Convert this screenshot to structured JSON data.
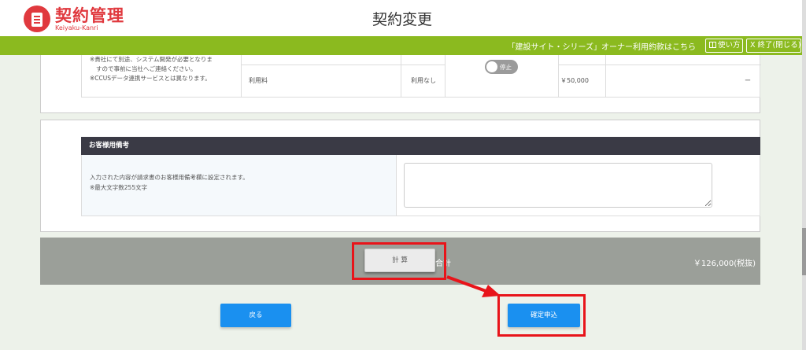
{
  "header": {
    "logo_title": "契約管理",
    "logo_sub": "Keiyaku-Kanri",
    "page_title": "契約変更"
  },
  "nav": {
    "terms_link": "「建設サイト・シリーズ」オーナー利用約款はこちら",
    "help_button": "使い方",
    "exit_button": "X 終了(閉じる)"
  },
  "fee_section": {
    "notes": [
      "※貴社にて別途、システム開発が必要となりま",
      "すので事前に当社へご連絡ください。",
      "※CCUSデータ連携サービスとは異なります。"
    ],
    "row_label": "利用料",
    "usage_status": "利用なし",
    "toggle_label": "停止",
    "price": "￥50,000",
    "dash": "ー"
  },
  "memo": {
    "heading": "お客様用備考",
    "note_line1": "入力された内容が請求書のお客様用備考欄に設定されます。",
    "note_line2": "※最大文字数255文字",
    "textarea_value": ""
  },
  "total": {
    "calc_button": "計 算",
    "label": "合計",
    "amount": "￥126,000(税抜)"
  },
  "actions": {
    "back_button": "戻る",
    "confirm_button": "確定申込"
  },
  "colors": {
    "brand_red": "#e0393e",
    "nav_green": "#8bba1f",
    "button_blue": "#1a90f0",
    "annotation_red": "#e8141a"
  }
}
